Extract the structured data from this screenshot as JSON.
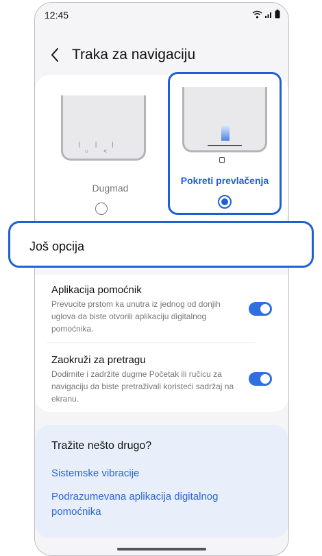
{
  "status_bar": {
    "time": "12:45",
    "icons": [
      "wifi-icon",
      "signal-icon",
      "battery-icon"
    ]
  },
  "header": {
    "title": "Traka za navigaciju",
    "back_icon": "chevron-left-icon"
  },
  "nav_options": [
    {
      "label": "Dugmad",
      "selected": false
    },
    {
      "label": "Pokreti prevlačenja",
      "selected": true
    }
  ],
  "more_options": {
    "label": "Još opcija"
  },
  "settings": [
    {
      "title": "Aplikacija pomoćnik",
      "description": "Prevucite prstom ka unutra iz jednog od donjih uglova da biste otvorili aplikaciju digitalnog pomoćnika.",
      "enabled": true
    },
    {
      "title": "Zaokruži za pretragu",
      "description": "Dodirnite i zadržite dugme Početak ili ručicu za navigaciju da biste pretraživali koristeći sadržaj na ekranu.",
      "enabled": true
    }
  ],
  "suggestions": {
    "title": "Tražite nešto drugo?",
    "links": [
      "Sistemske vibracije",
      "Podrazumevana aplikacija digitalnog pomoćnika"
    ]
  },
  "colors": {
    "accent": "#1f5fd6",
    "toggle_on": "#2f6fe0",
    "link": "#2a66d3"
  }
}
